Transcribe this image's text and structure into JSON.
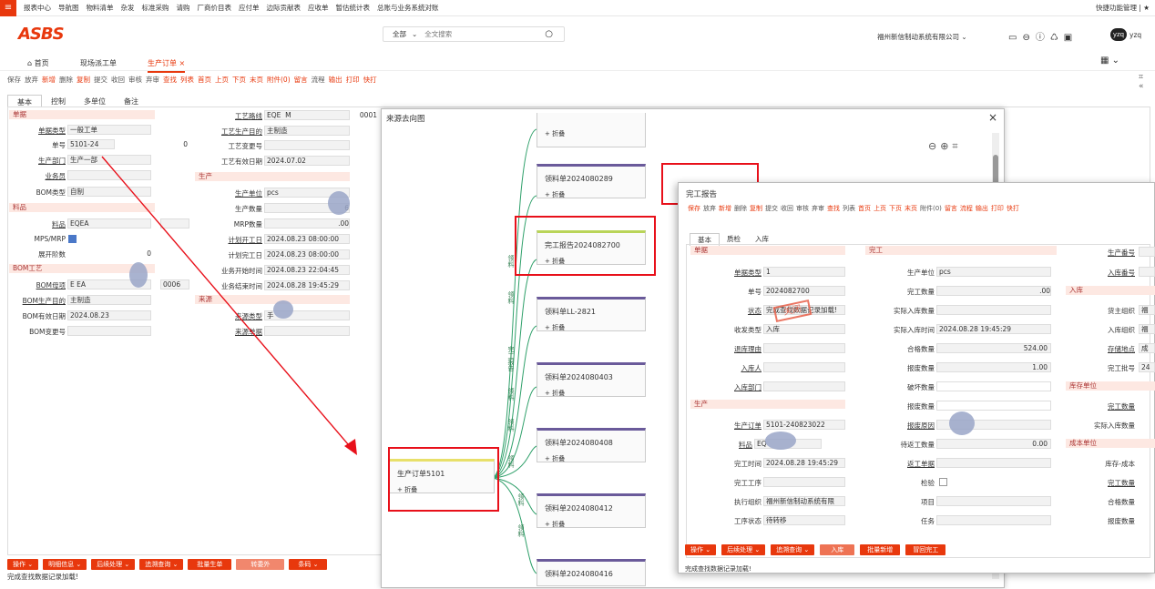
{
  "topbar": {
    "menu": [
      "报表中心",
      "导航图",
      "物料清单",
      "杂发",
      "标准采购",
      "请购",
      "厂商价目表",
      "应付单",
      "边际贡献表",
      "应收单",
      "暂估统计表",
      "总账与业务系统对账"
    ],
    "right": "快捷功能管理"
  },
  "header": {
    "logo": "ASBS",
    "search_scope": "全部",
    "search_placeholder": "全文搜索",
    "company": "福州新信制动系统有限公司",
    "user": "yzq",
    "avatar": "yzq"
  },
  "tabs": {
    "home": "首页",
    "t1": "现场派工单",
    "t2": "生产订单"
  },
  "toolbar": [
    "保存",
    "放弃",
    "新增",
    "删除",
    "复制",
    "提交",
    "收回",
    "审核",
    "弃审",
    "查找",
    "列表",
    "首页",
    "上页",
    "下页",
    "末页",
    "附件(0)",
    "留言",
    "流程",
    "输出",
    "打印",
    "快打"
  ],
  "subtabs": [
    "基本",
    "控制",
    "多单位",
    "备注"
  ],
  "form": {
    "sec_doc": "单据",
    "doc_type_label": "单据类型",
    "doc_type": "一般工单",
    "no_label": "单号",
    "no": "5101-24",
    "no_extra": "0",
    "dept_label": "生产部门",
    "dept": "生产一部",
    "sales_label": "业务员",
    "bom_type_label": "BOM类型",
    "bom_type": "自制",
    "sec_item": "料品",
    "item_label": "料品",
    "item": "EQEA",
    "mps_label": "MPS/MRP",
    "bom_level_label": "展开阶数",
    "bom_level": "0",
    "sec_bom": "BOM工艺",
    "bom_parent_label": "BOM母项",
    "bom_parent": "E EA",
    "bom_parent_code": "0006",
    "bom_purpose_label": "BOM生产目的",
    "bom_purpose": "主制造",
    "bom_date_label": "BOM有效日期",
    "bom_date": "2024.08.23",
    "bom_change_label": "BOM变更号",
    "route_label": "工艺路线",
    "route": "EQE",
    "route_mid": "M",
    "route_code": "0001",
    "proc_purpose_label": "工艺生产目的",
    "proc_purpose": "主制造",
    "proc_change_label": "工艺变更号",
    "proc_date_label": "工艺有效日期",
    "proc_date": "2024.07.02",
    "sec_prod": "生产",
    "unit_label": "生产单位",
    "unit": "pcs",
    "qty_label": "生产数量",
    "qty": "6",
    "mrp_label": "MRP数量",
    "mrp": ".00",
    "plan_start_label": "计划开工日",
    "plan_start": "2024.08.23 08:00:00",
    "plan_end_label": "计划完工日",
    "plan_end": "2024.08.23 08:00:00",
    "biz_start_label": "业务开始时间",
    "biz_start": "2024.08.23 22:04:45",
    "biz_end_label": "业务结束时间",
    "biz_end": "2024.08.28 19:45:29",
    "sec_src": "来源",
    "src_type_label": "来源类型",
    "src_type": "手",
    "src_no_label": "来源单据"
  },
  "bottom_buttons": [
    "操作",
    "明细信息",
    "后续处理",
    "追溯查询",
    "批量生单",
    "转委外",
    "条码"
  ],
  "status": "完成查找数据记录加载!",
  "flow": {
    "title": "来源去向图",
    "close": "×",
    "nodes": [
      "领料单2024080289",
      "完工报告2024082700",
      "领料单LL-2821",
      "领料单2024080403",
      "领料单2024080408",
      "领料单2024080412",
      "领料单2024080416"
    ],
    "fold": "折叠",
    "root": "生产订单5101",
    "edges": [
      "领料",
      "领料",
      "完工报告",
      "领料",
      "领料",
      "领料",
      "领料",
      "领料"
    ]
  },
  "report": {
    "title": "完工报告",
    "toolbar": [
      "保存",
      "放弃",
      "新增",
      "删除",
      "复制",
      "提交",
      "收回",
      "审核",
      "弃审",
      "查找",
      "列表",
      "首页",
      "上页",
      "下页",
      "末页",
      "附件(0)",
      "留言",
      "流程",
      "输出",
      "打印",
      "快打"
    ],
    "tabs": [
      "基本",
      "质检",
      "入库"
    ],
    "sec_doc": "单据",
    "doc_type_label": "单据类型",
    "doc_type": "1",
    "no_label": "单号",
    "no": "2024082700",
    "status_label": "状态",
    "status": "完成查找数据记录加载!",
    "stamp": "关闭",
    "rd_label": "收发类型",
    "rd": "入库",
    "reason_label": "退库理由",
    "in_person_label": "入库人",
    "in_dept_label": "入库部门",
    "sec_prod": "生产",
    "order_label": "生产订单",
    "order": "5101-240823022",
    "item_label": "料品",
    "item": "EQ",
    "time_label": "完工时间",
    "time": "2024.08.28 19:45:29",
    "proc_label": "完工工序",
    "org_label": "执行组织",
    "org": "福州新信制动系统有限",
    "state_label": "工序状态",
    "state": "待转移",
    "sec_done": "完工",
    "unit_label": "生产单位",
    "unit": "pcs",
    "done_qty_label": "完工数量",
    "done_qty": ".00",
    "act_in_label": "实际入库数量",
    "act_in_time_label": "实际入库时间",
    "act_in_time": "2024.08.28 19:45:29",
    "ok_label": "合格数量",
    "ok": "524.00",
    "scrap_label": "报废数量",
    "scrap": "1.00",
    "broken_label": "破坏数量",
    "report_label": "报废数量",
    "scrap_reason_label": "报废原因",
    "wait_label": "待返工数量",
    "wait": "0.00",
    "rework_label": "返工单据",
    "inspect_label": "检验",
    "project_label": "项目",
    "task_label": "任务",
    "r_prod_no": "生产番号",
    "r_in_no": "入库番号",
    "r_sec_in": "入库",
    "r_cost_org": "货主组织",
    "r_cost_org_val": "福",
    "r_in_org": "入库组织",
    "r_in_org_val": "福",
    "r_store": "存储地点",
    "r_store_val": "成",
    "r_lot": "完工批号",
    "r_lot_val": "24",
    "r_sec_stock": "库存单位",
    "r_done": "完工数量",
    "r_act": "实际入库数量",
    "r_sec_cost": "成本单位",
    "r_inv": "库存-成本",
    "r_done2": "完工数量",
    "r_ok": "合格数量",
    "r_scrap": "报废数量",
    "buttons": [
      "操作",
      "后续处理",
      "追溯查询",
      "入库",
      "批量新增",
      "冒回完工"
    ]
  }
}
